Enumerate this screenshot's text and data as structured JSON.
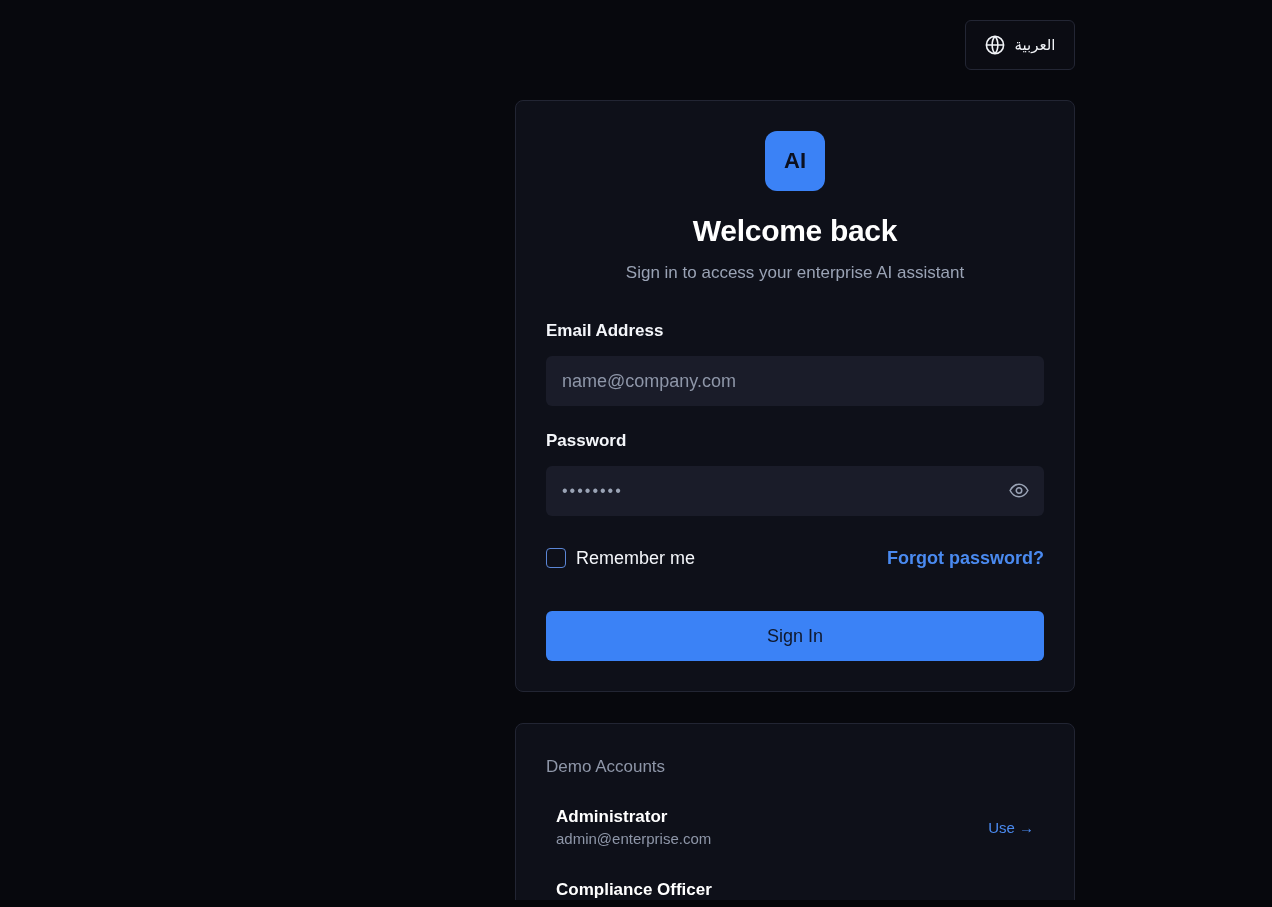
{
  "language_button": {
    "label": "العربية"
  },
  "login_card": {
    "logo": "AI",
    "title": "Welcome back",
    "subtitle": "Sign in to access your enterprise AI assistant",
    "email": {
      "label": "Email Address",
      "placeholder": "name@company.com"
    },
    "password": {
      "label": "Password",
      "value": "••••••••"
    },
    "remember_me": {
      "label": "Remember me",
      "checked": false
    },
    "forgot_link": "Forgot password?",
    "submit_button": "Sign In"
  },
  "demo_accounts": {
    "title": "Demo Accounts",
    "accounts": [
      {
        "name": "Administrator",
        "email": "admin@enterprise.com",
        "action": "Use →"
      },
      {
        "name": "Compliance Officer"
      }
    ]
  }
}
